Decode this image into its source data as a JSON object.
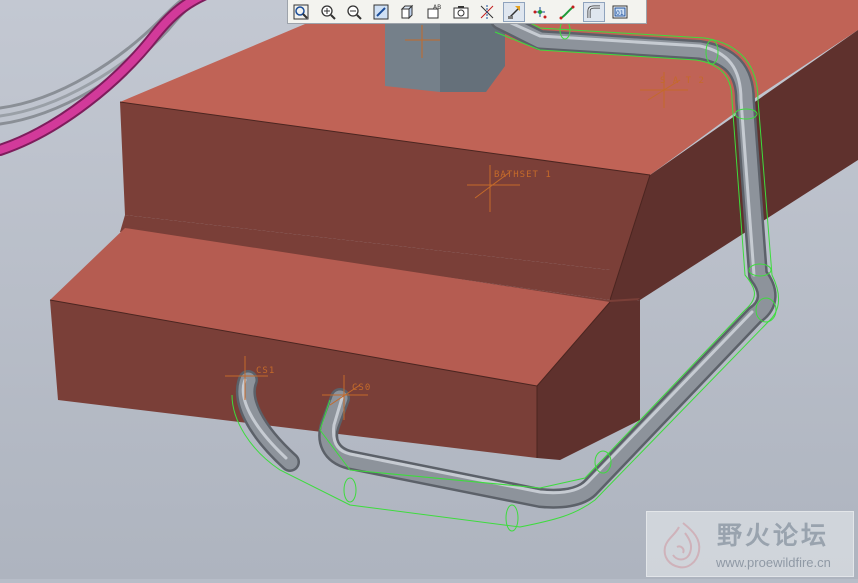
{
  "toolbar": {
    "buttons": [
      {
        "id": "refit",
        "icon": "zoom-fit-icon"
      },
      {
        "id": "zoom-in",
        "icon": "zoom-in-icon"
      },
      {
        "id": "zoom-out",
        "icon": "zoom-out-icon"
      },
      {
        "id": "repaint",
        "icon": "repaint-icon"
      },
      {
        "id": "display-style",
        "icon": "display-style-icon"
      },
      {
        "id": "saved-views",
        "icon": "saved-views-icon"
      },
      {
        "id": "view-manager",
        "icon": "camera-icon"
      },
      {
        "id": "datum-planes",
        "icon": "datum-planes-icon"
      },
      {
        "id": "datum-axes",
        "icon": "datum-axes-icon"
      },
      {
        "id": "datum-points",
        "icon": "datum-points-icon"
      },
      {
        "id": "csys",
        "icon": "csys-icon"
      },
      {
        "id": "pipe",
        "icon": "pipe-icon"
      },
      {
        "id": "annotations",
        "icon": "annotation-icon"
      }
    ],
    "active_button": "datum-axes"
  },
  "model": {
    "csys_labels": {
      "top": "S A T 2",
      "middle": "BATHSET 1",
      "port_in": "CS1",
      "port_out": "CS0"
    },
    "colors": {
      "background": "#b7bdc8",
      "block_face": "#b55c51",
      "block_front": "#7a3f38",
      "block_side": "#5e302d",
      "pipe": "#8d939b",
      "selection": "#3ddc3d",
      "csys": "#c46a2a",
      "cable": "#d23a9a"
    }
  },
  "watermark": {
    "title": "野火论坛",
    "url": "www.proewildfire.cn"
  }
}
